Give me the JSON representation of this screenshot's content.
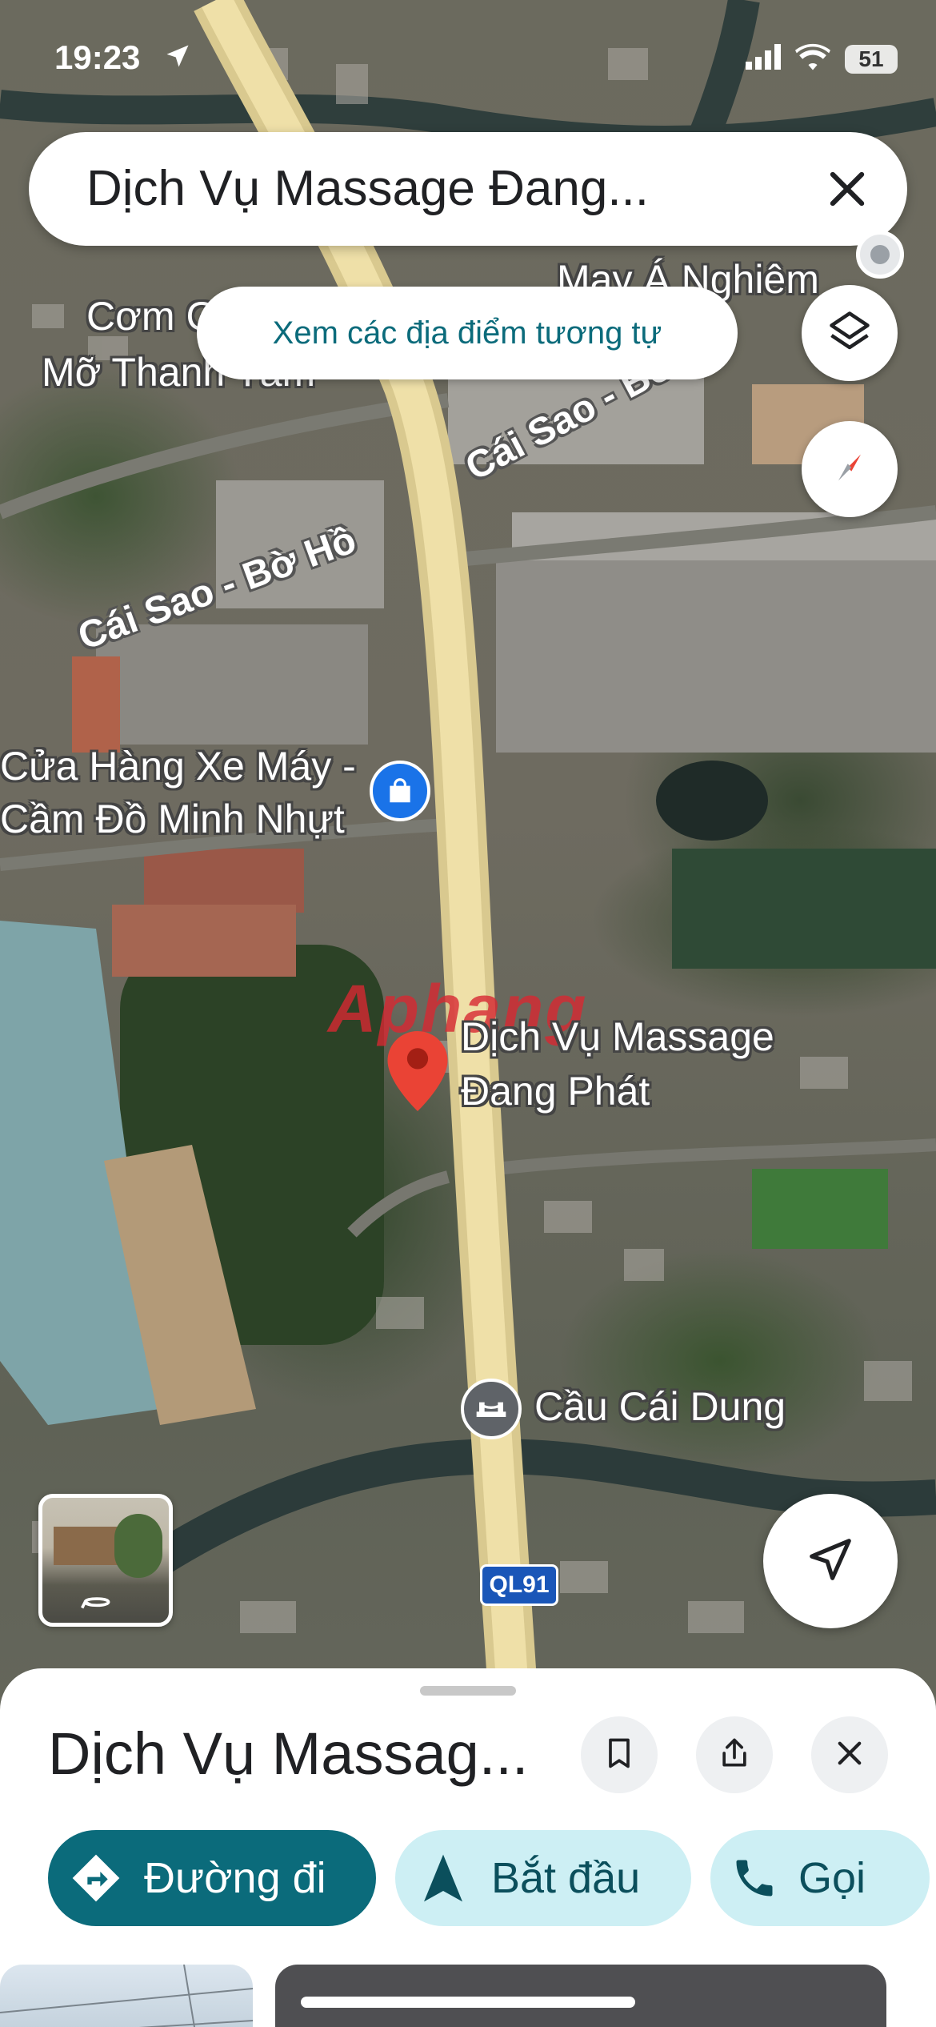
{
  "status_bar": {
    "time": "19:23",
    "battery": "51"
  },
  "search": {
    "query": "Dịch Vụ Massage Đang...",
    "close_icon": "close-icon"
  },
  "similar_places_chip": "Xem các địa điểm tương tự",
  "map": {
    "labels": {
      "com": "Cơm G",
      "mo_thanh_tam": "Mỡ Thanh Tâm",
      "may": "May Á Nghiêm",
      "road_cai_sao_1": "Cái Sao - Bờ Hồ",
      "road_cai_sao_2": "Cái Sao - Bờ Hồ",
      "cua_hang_line1": "Cửa Hàng Xe Máy -",
      "cua_hang_line2": "Cầm Đồ Minh Nhựt",
      "selected_line1": "Dịch Vụ Massage",
      "selected_line2": "Đang Phát",
      "cau_cai_dung": "Cầu Cái Dung",
      "route_shield": "QL91",
      "watermark": "Aphang"
    },
    "colors": {
      "highway": "#e9d79a",
      "pin": "#ea4335",
      "poi_shop": "#1a73e8",
      "poi_bridge": "#5f6368"
    }
  },
  "sheet": {
    "title": "Dịch Vụ Massag...",
    "actions": {
      "directions": "Đường đi",
      "start": "Bắt đầu",
      "call": "Gọi"
    },
    "colors": {
      "primary": "#0b6b7b",
      "secondary_bg": "#cdeff4"
    }
  }
}
